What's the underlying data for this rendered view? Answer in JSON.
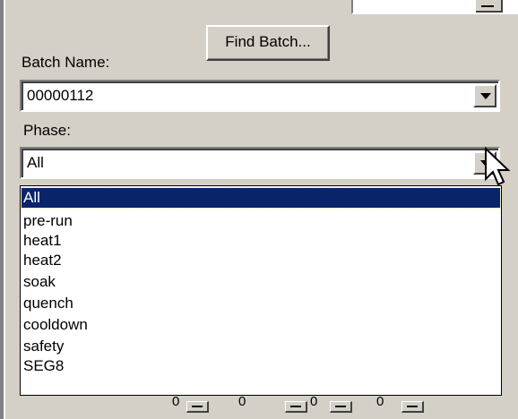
{
  "find_button": {
    "label": "Find Batch...",
    "mnemonic": "F"
  },
  "batch": {
    "label": "Batch Name:",
    "value": "00000112"
  },
  "phase": {
    "label": "Phase:",
    "value": "All",
    "options": [
      "All",
      "pre-run",
      "heat1",
      "heat2",
      "soak",
      "quench",
      "cooldown",
      "safety",
      "SEG8"
    ],
    "selected_index": 0
  },
  "bottom_row": {
    "values": [
      "0",
      "0",
      "0",
      "0"
    ]
  },
  "colors": {
    "face": "#d4d0c8",
    "selection": "#0a246a",
    "field": "#ffffff"
  }
}
